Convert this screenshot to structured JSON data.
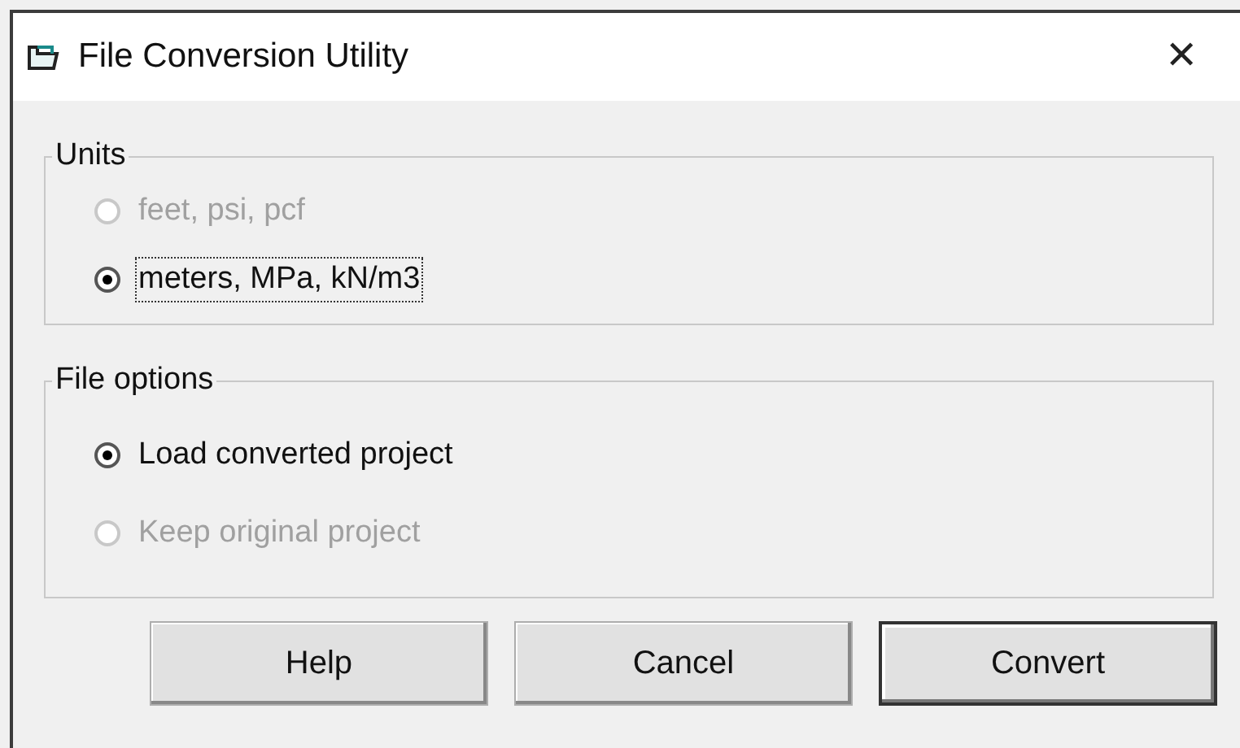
{
  "window": {
    "title": "File Conversion Utility",
    "close_glyph": "✕"
  },
  "groups": [
    {
      "title": "Units",
      "options": [
        {
          "label": "feet, psi, pcf",
          "selected": false,
          "disabled": true,
          "focused": false
        },
        {
          "label": "meters, MPa, kN/m3",
          "selected": true,
          "disabled": false,
          "focused": true
        }
      ]
    },
    {
      "title": "File options",
      "options": [
        {
          "label": "Load converted project",
          "selected": true,
          "disabled": false,
          "focused": false
        },
        {
          "label": "Keep original project",
          "selected": false,
          "disabled": true,
          "focused": false
        }
      ]
    }
  ],
  "buttons": [
    {
      "label": "Help",
      "default": false
    },
    {
      "label": "Cancel",
      "default": false
    },
    {
      "label": "Convert",
      "default": true
    }
  ]
}
